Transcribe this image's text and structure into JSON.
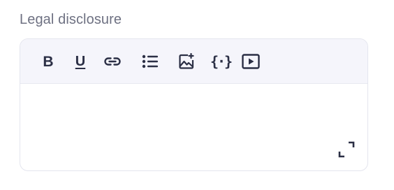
{
  "field": {
    "label": "Legal disclosure",
    "content": ""
  },
  "toolbar": {
    "bold_label": "B",
    "underline_label": "U",
    "code_label": "{·}",
    "buttons": [
      {
        "name": "bold",
        "icon": "bold-icon"
      },
      {
        "name": "underline",
        "icon": "underline-icon"
      },
      {
        "name": "link",
        "icon": "link-icon"
      },
      {
        "name": "bulleted-list",
        "icon": "bulleted-list-icon"
      },
      {
        "name": "insert-image",
        "icon": "image-add-icon"
      },
      {
        "name": "code-variable",
        "icon": "curly-braces-icon"
      },
      {
        "name": "insert-video",
        "icon": "play-video-icon"
      }
    ]
  },
  "colors": {
    "label": "#6e7182",
    "icon": "#2b2f45",
    "toolbar_bg": "#f5f5fb",
    "border": "#e4e5ee"
  }
}
